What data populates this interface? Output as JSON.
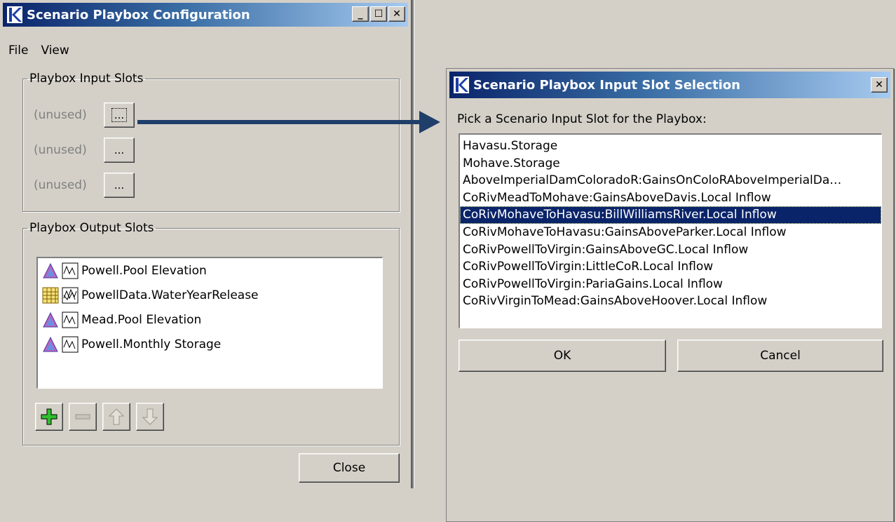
{
  "config_window": {
    "title": "Scenario Playbox Configuration",
    "menu": [
      "File",
      "View"
    ],
    "input_group": {
      "legend": "Playbox Input Slots",
      "slots": [
        {
          "label": "(unused)",
          "button": "..."
        },
        {
          "label": "(unused)",
          "button": "..."
        },
        {
          "label": "(unused)",
          "button": "..."
        }
      ]
    },
    "output_group": {
      "legend": "Playbox Output Slots",
      "items": [
        {
          "label": "Powell.Pool Elevation",
          "kind": "reservoir"
        },
        {
          "label": "PowellData.WaterYearRelease",
          "kind": "data"
        },
        {
          "label": "Mead.Pool Elevation",
          "kind": "reservoir"
        },
        {
          "label": "Powell.Monthly Storage",
          "kind": "reservoir"
        }
      ]
    },
    "close_label": "Close"
  },
  "selection_dialog": {
    "title": "Scenario Playbox Input Slot Selection",
    "prompt": "Pick a Scenario Input Slot for the Playbox:",
    "items": [
      "Havasu.Storage",
      "Mohave.Storage",
      "AboveImperialDamColoradoR:GainsOnColoRAboveImperialDa…",
      "CoRivMeadToMohave:GainsAboveDavis.Local Inflow",
      "CoRivMohaveToHavasu:BillWilliamsRiver.Local Inflow",
      "CoRivMohaveToHavasu:GainsAboveParker.Local Inflow",
      "CoRivPowellToVirgin:GainsAboveGC.Local Inflow",
      "CoRivPowellToVirgin:LittleCoR.Local Inflow",
      "CoRivPowellToVirgin:PariaGains.Local Inflow",
      "CoRivVirginToMead:GainsAboveHoover.Local Inflow"
    ],
    "selected_index": 4,
    "ok_label": "OK",
    "cancel_label": "Cancel"
  },
  "colors": {
    "title_start": "#0a246a",
    "title_end": "#a6caf0",
    "selection": "#0a246a",
    "arrow": "#1f3f6a"
  }
}
